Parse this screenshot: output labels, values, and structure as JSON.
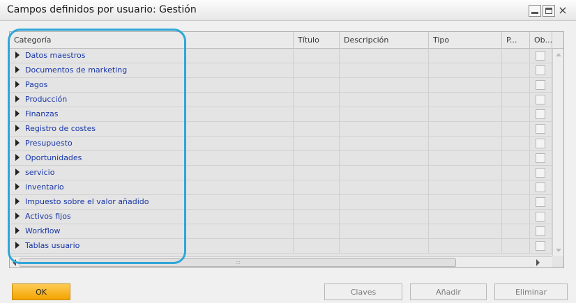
{
  "window": {
    "title": "Campos definidos por usuario: Gestión",
    "close_glyph": "×"
  },
  "grid": {
    "columns": [
      "Categoría",
      "Título",
      "Descripción",
      "Tipo",
      "P...",
      "Ob..."
    ],
    "rows": [
      "Datos maestros",
      "Documentos de marketing",
      "Pagos",
      "Producción",
      "Finanzas",
      "Registro de costes",
      "Presupuesto",
      "Oportunidades",
      "servicio",
      "inventario",
      "Impuesto sobre el valor añadido",
      "Activos fijos",
      "Workflow",
      "Tablas usuario"
    ],
    "scroll_grip": ":::"
  },
  "buttons": {
    "ok": "OK",
    "claves": "Claves",
    "anadir": "Añadir",
    "eliminar": "Eliminar"
  },
  "colors": {
    "link": "#1836a8",
    "highlight": "#2fa6d8",
    "ok_button": "#f2a300"
  }
}
